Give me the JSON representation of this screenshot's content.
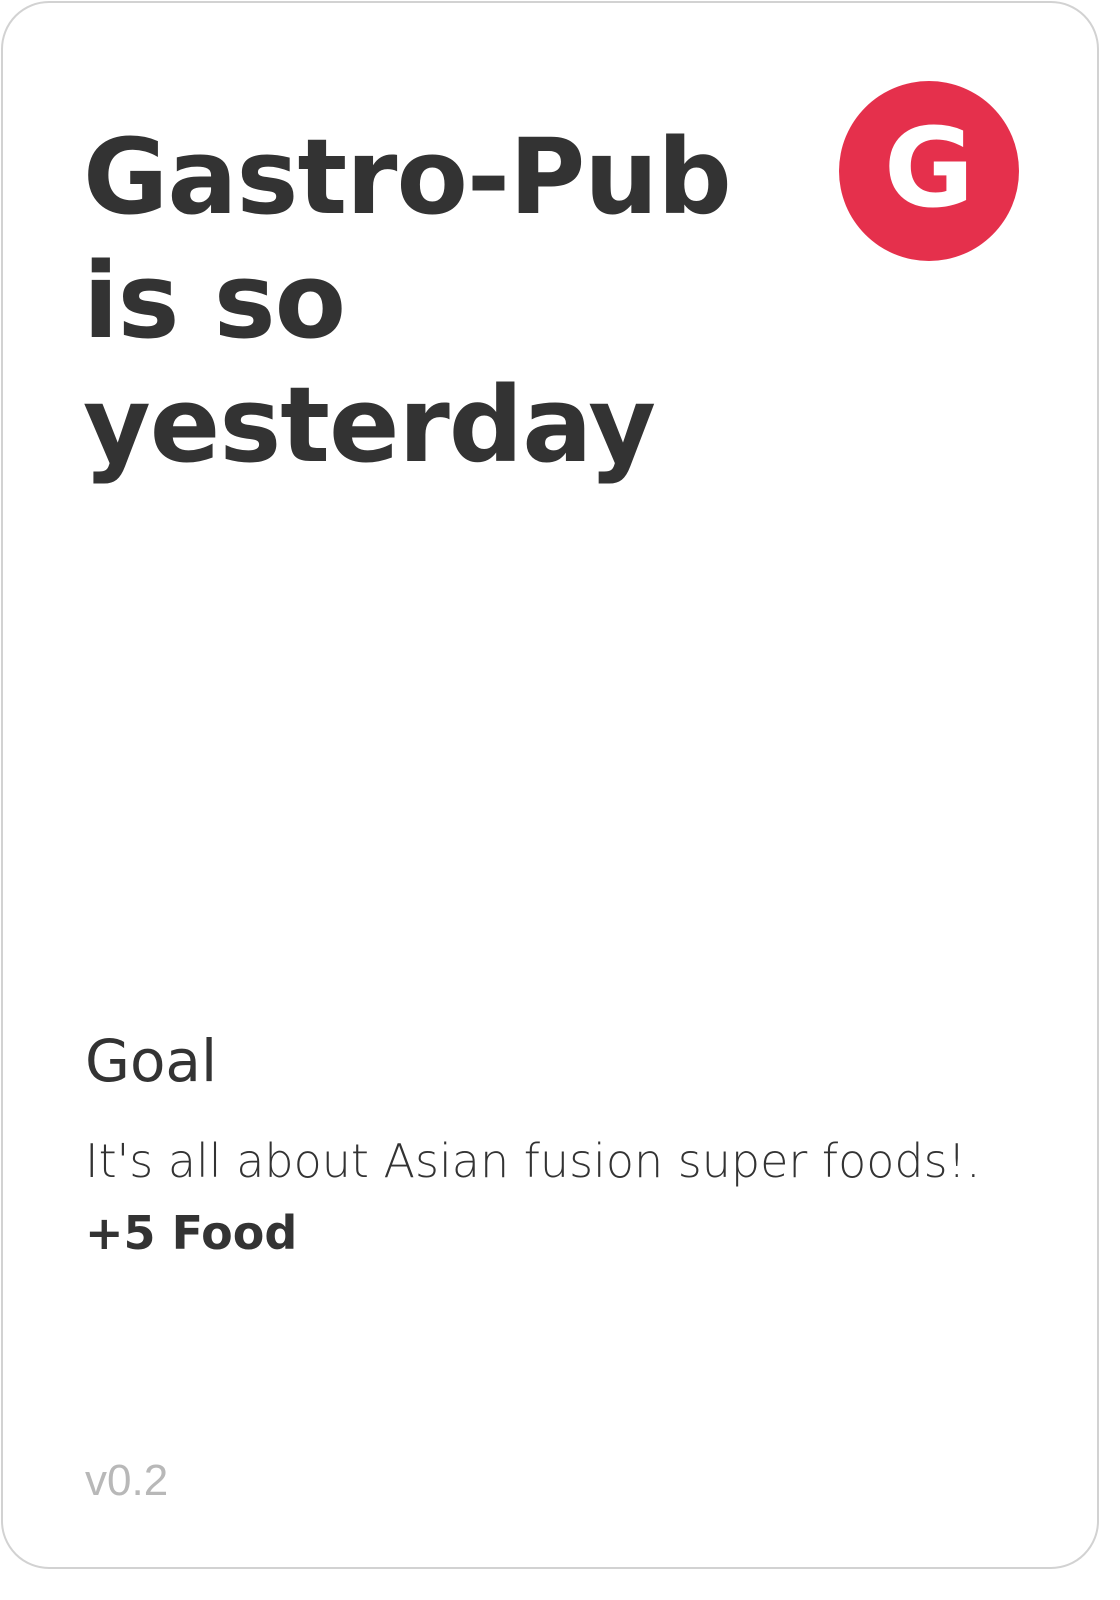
{
  "card": {
    "title_lines": [
      "Gastro-Pub",
      "is so",
      "yesterday"
    ],
    "badge": {
      "letter": "G",
      "color": "#e5304c"
    },
    "goal": {
      "label": "Goal",
      "description": "It's all about Asian fusion super foods!.",
      "reward": "+5 Food"
    },
    "version": "v0.2"
  },
  "colors": {
    "text": "#333333",
    "accent": "#e5304c",
    "muted": "#b8b8b8",
    "border": "#d2d2d2"
  }
}
